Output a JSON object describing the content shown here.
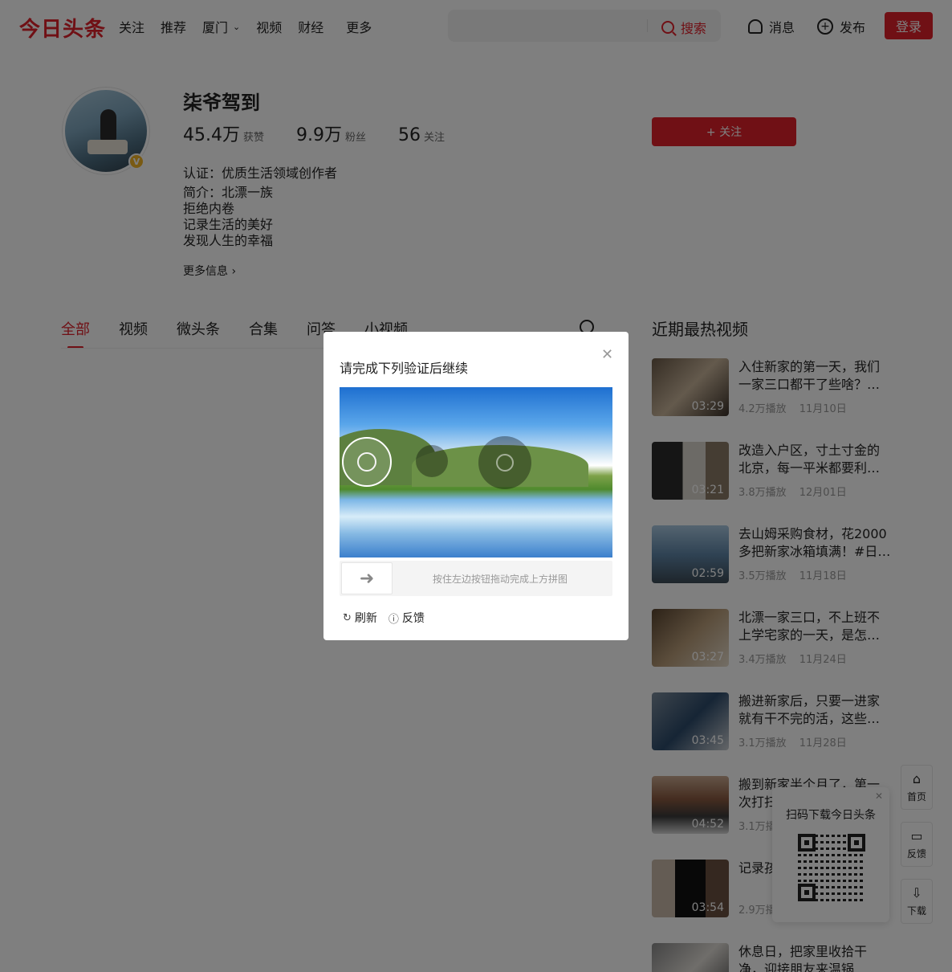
{
  "header": {
    "logo": "今日头条",
    "nav": [
      {
        "label": "关注"
      },
      {
        "label": "推荐"
      },
      {
        "label": "厦门",
        "has_dropdown": true
      },
      {
        "label": "视频"
      },
      {
        "label": "财经"
      },
      {
        "label": "更多"
      }
    ],
    "search_label": "搜索",
    "messages_label": "消息",
    "publish_label": "发布",
    "login_label": "登录"
  },
  "profile": {
    "name": "柒爷驾到",
    "stats": [
      {
        "num": "45.4万",
        "label": "获赞"
      },
      {
        "num": "9.9万",
        "label": "粉丝"
      },
      {
        "num": "56",
        "label": "关注"
      }
    ],
    "certification": "认证：优质生活领域创作者",
    "bio_lines": [
      "简介：北漂一族",
      "拒绝内卷",
      "记录生活的美好",
      "发现人生的幸福"
    ],
    "more_info": "更多信息 ›",
    "follow_label": "+ 关注",
    "verified_mark": "V"
  },
  "tabs": [
    {
      "label": "全部",
      "active": true
    },
    {
      "label": "视频"
    },
    {
      "label": "微头条"
    },
    {
      "label": "合集"
    },
    {
      "label": "问答"
    },
    {
      "label": "小视频"
    }
  ],
  "sidebar": {
    "title": "近期最热视频",
    "videos": [
      {
        "title": "入住新家的第一天，我们一家三口都干了些啥？…",
        "duration": "03:29",
        "plays": "4.2万播放",
        "date": "11月10日"
      },
      {
        "title": "改造入户区，寸土寸金的北京，每一平米都要利…",
        "duration": "03:21",
        "plays": "3.8万播放",
        "date": "12月01日"
      },
      {
        "title": "去山姆采购食材，花2000多把新家冰箱填满！#日…",
        "duration": "02:59",
        "plays": "3.5万播放",
        "date": "11月18日"
      },
      {
        "title": "北漂一家三口，不上班不上学宅家的一天，是怎…",
        "duration": "03:27",
        "plays": "3.4万播放",
        "date": "11月24日"
      },
      {
        "title": "搬进新家后，只要一进家就有干不完的活，这些…",
        "duration": "03:45",
        "plays": "3.1万播放",
        "date": "11月28日"
      },
      {
        "title": "搬到新家半个月了，第一次打扫…",
        "duration": "04:52",
        "plays": "3.1万播放",
        "date": ""
      },
      {
        "title": "记录孩…班，我…",
        "duration": "03:54",
        "plays": "2.9万播放",
        "date": ""
      },
      {
        "title": "休息日，把家里收拾干净，迎接朋友来温锅",
        "duration": "",
        "plays": "",
        "date": ""
      }
    ]
  },
  "float_tools": [
    {
      "label": "首页",
      "icon": "home-icon"
    },
    {
      "label": "反馈",
      "icon": "feedback-icon"
    },
    {
      "label": "下载",
      "icon": "download-icon"
    }
  ],
  "qr_popup": {
    "title": "扫码下载今日头条"
  },
  "captcha": {
    "title": "请完成下列验证后继续",
    "hint": "按住左边按钮拖动完成上方拼图",
    "refresh_label": "刷新",
    "feedback_label": "反馈"
  },
  "colors": {
    "accent": "#e0202b",
    "overlay": "rgba(0,0,0,0.5)"
  }
}
